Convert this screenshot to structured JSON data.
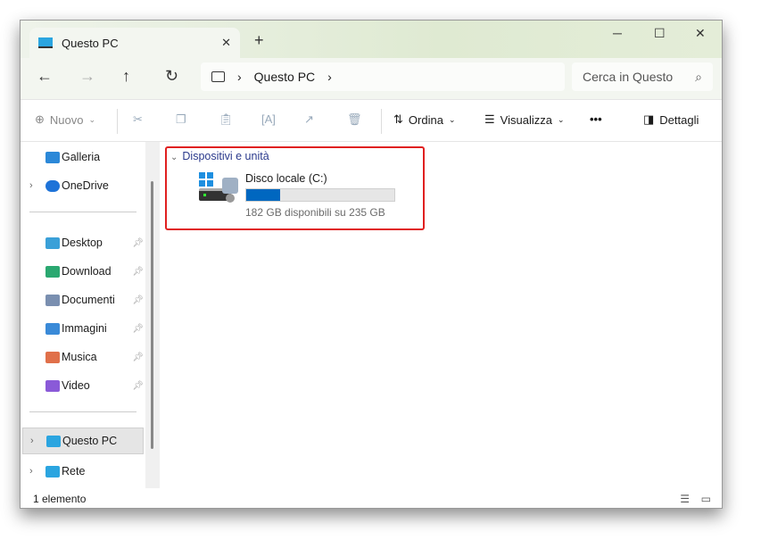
{
  "tab": {
    "title": "Questo PC"
  },
  "address": {
    "crumb": "Questo PC"
  },
  "search": {
    "placeholder": "Cerca in Questo"
  },
  "toolbar": {
    "new": "Nuovo",
    "sort": "Ordina",
    "view": "Visualizza",
    "more": "•••",
    "details": "Dettagli"
  },
  "sidebar": {
    "items": [
      {
        "label": "Galleria",
        "color": "#2b88d8"
      },
      {
        "label": "OneDrive",
        "color": "#1e73d8"
      },
      {
        "label": "Desktop",
        "color": "#3aa0d8"
      },
      {
        "label": "Download",
        "color": "#2aa870"
      },
      {
        "label": "Documenti",
        "color": "#7a8fb0"
      },
      {
        "label": "Immagini",
        "color": "#3a8ad8"
      },
      {
        "label": "Musica",
        "color": "#e0704a"
      },
      {
        "label": "Video",
        "color": "#8a5ad8"
      },
      {
        "label": "Questo PC",
        "color": "#2ba5e0"
      },
      {
        "label": "Rete",
        "color": "#2ba5e0"
      }
    ]
  },
  "content": {
    "group": "Dispositivi e unità",
    "drive": {
      "name": "Disco locale (C:)",
      "free": "182 GB disponibili su 235 GB",
      "used_percent": 22.6
    }
  },
  "status": {
    "count": "1 elemento"
  }
}
